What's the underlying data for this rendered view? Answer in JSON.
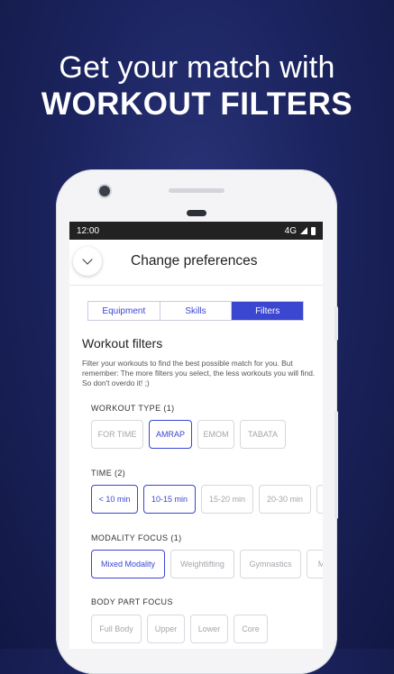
{
  "promo": {
    "line1": "Get your match with",
    "line2": "WORKOUT FILTERS"
  },
  "status": {
    "time": "12:00",
    "network": "4G"
  },
  "header": {
    "title": "Change preferences"
  },
  "tabs": [
    {
      "label": "Equipment",
      "active": false
    },
    {
      "label": "Skills",
      "active": false
    },
    {
      "label": "Filters",
      "active": true
    }
  ],
  "filters": {
    "title": "Workout filters",
    "description": "Filter your workouts to find the best possible match for you. But remember: The more filters you select, the less workouts you will find. So don't overdo it! ;)",
    "groups": [
      {
        "label": "WORKOUT TYPE (1)",
        "options": [
          {
            "label": "FOR TIME",
            "selected": false
          },
          {
            "label": "AMRAP",
            "selected": true
          },
          {
            "label": "EMOM",
            "selected": false
          },
          {
            "label": "TABATA",
            "selected": false
          }
        ]
      },
      {
        "label": "TIME (2)",
        "options": [
          {
            "label": "< 10 min",
            "selected": true
          },
          {
            "label": "10-15 min",
            "selected": true
          },
          {
            "label": "15-20 min",
            "selected": false
          },
          {
            "label": "20-30 min",
            "selected": false
          },
          {
            "label": "",
            "selected": false
          }
        ]
      },
      {
        "label": "MODALITY FOCUS (1)",
        "options": [
          {
            "label": "Mixed Modality",
            "selected": true
          },
          {
            "label": "Weightlifting",
            "selected": false
          },
          {
            "label": "Gymnastics",
            "selected": false
          },
          {
            "label": "Mo",
            "selected": false
          }
        ]
      },
      {
        "label": "BODY PART FOCUS",
        "options": [
          {
            "label": "Full Body",
            "selected": false
          },
          {
            "label": "Upper",
            "selected": false
          },
          {
            "label": "Lower",
            "selected": false
          },
          {
            "label": "Core",
            "selected": false
          }
        ]
      }
    ]
  },
  "colors": {
    "accent": "#3b46d1",
    "background": "#1c2460"
  }
}
